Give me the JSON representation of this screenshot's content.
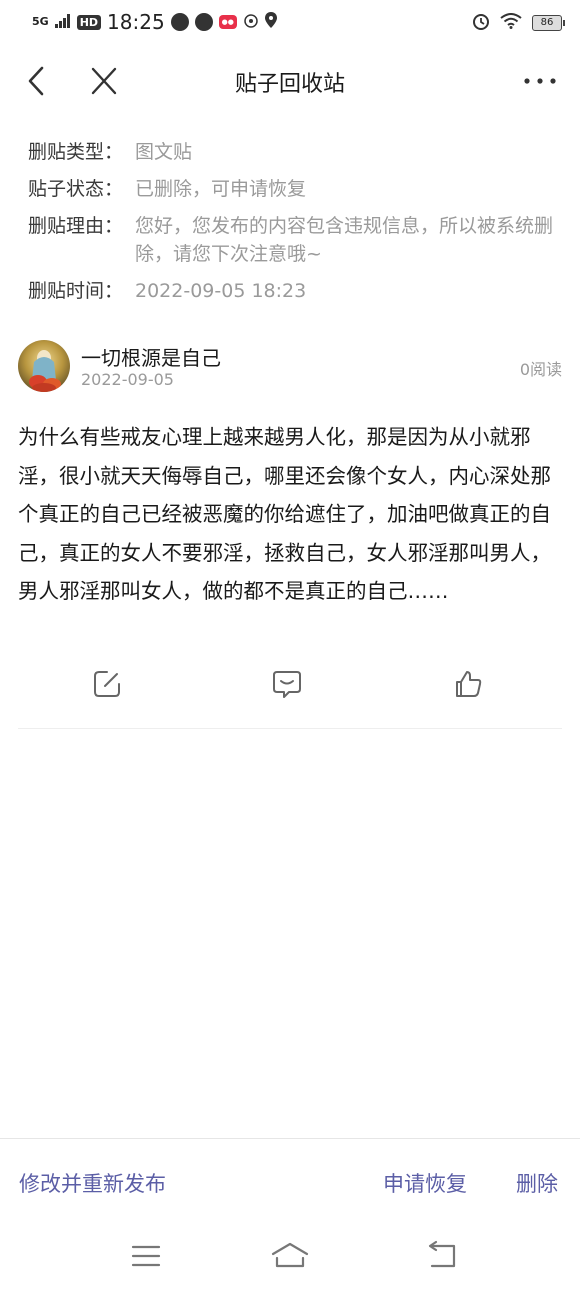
{
  "status_bar": {
    "network": "5G",
    "hd": "HD",
    "time": "18:25",
    "battery": "86"
  },
  "nav": {
    "title": "贴子回收站"
  },
  "info": [
    {
      "label": "删贴类型：",
      "value": "图文贴"
    },
    {
      "label": "贴子状态：",
      "value": "已删除，可申请恢复"
    },
    {
      "label": "删贴理由：",
      "value": "您好，您发布的内容包含违规信息，所以被系统删除，请您下次注意哦~"
    },
    {
      "label": "删贴时间：",
      "value": "2022-09-05 18:23"
    }
  ],
  "post": {
    "author": "一切根源是自己",
    "date": "2022-09-05",
    "reads": "0阅读",
    "content": "为什么有些戒友心理上越来越男人化，那是因为从小就邪淫，很小就天天侮辱自己，哪里还会像个女人，内心深处那个真正的自己已经被恶魔的你给遮住了，加油吧做真正的自己，真正的女人不要邪淫，拯救自己，女人邪淫那叫男人，男人邪淫那叫女人，做的都不是真正的自己……"
  },
  "bottom": {
    "edit_label": "修改并重新发布",
    "restore_label": "申请恢复",
    "delete_label": "删除"
  },
  "colors": {
    "accent": "#5b5ea6",
    "muted": "#9a9a9a"
  }
}
